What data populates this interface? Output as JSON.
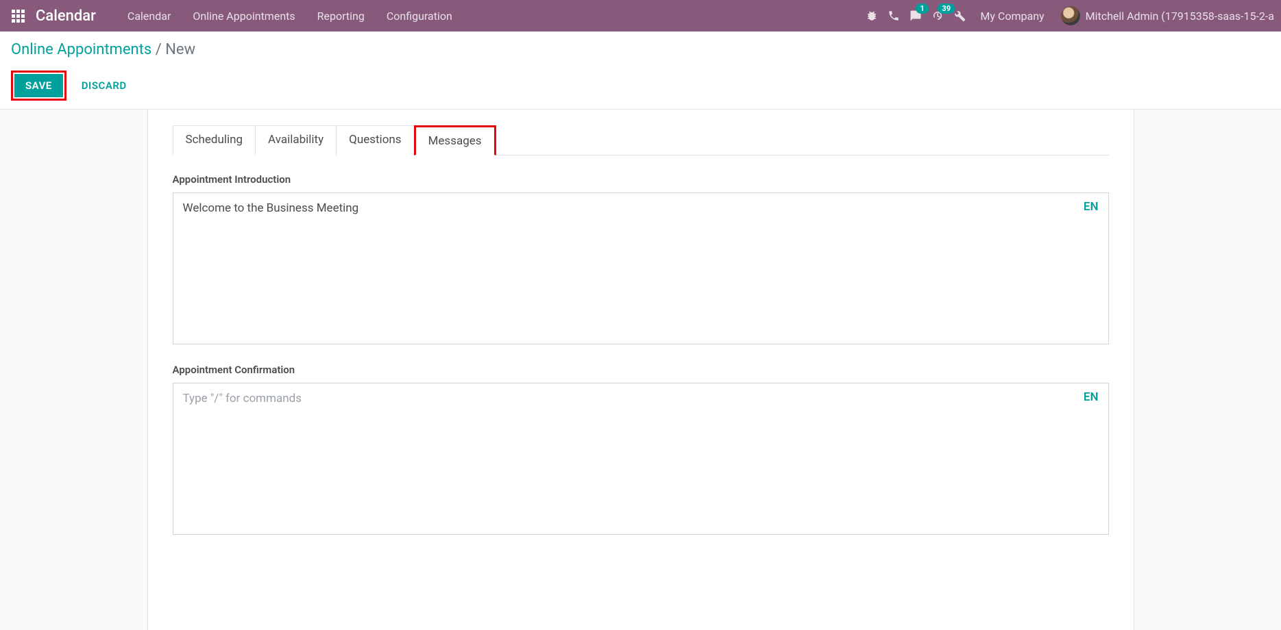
{
  "nav": {
    "app_title": "Calendar",
    "items": [
      "Calendar",
      "Online Appointments",
      "Reporting",
      "Configuration"
    ],
    "messages_badge": "1",
    "activities_badge": "39",
    "company": "My Company",
    "user": "Mitchell Admin (17915358-saas-15-2-a"
  },
  "breadcrumb": {
    "parent": "Online Appointments",
    "current": "New"
  },
  "buttons": {
    "save": "SAVE",
    "discard": "DISCARD"
  },
  "tabs": [
    "Scheduling",
    "Availability",
    "Questions",
    "Messages"
  ],
  "active_tab_index": 3,
  "fields": {
    "intro_label": "Appointment Introduction",
    "intro_value": "Welcome to the Business Meeting",
    "intro_lang": "EN",
    "confirm_label": "Appointment Confirmation",
    "confirm_placeholder": "Type \"/\" for commands",
    "confirm_lang": "EN"
  }
}
